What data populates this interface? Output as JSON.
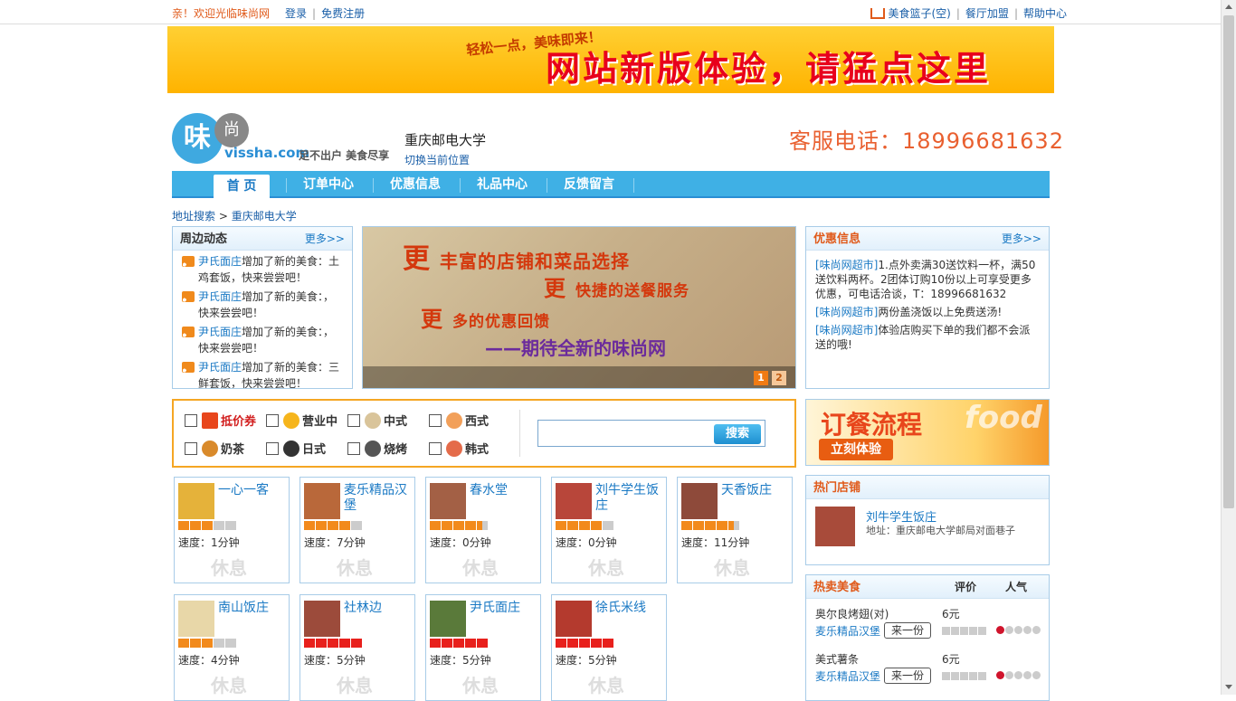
{
  "topbar": {
    "welcome": "亲！欢迎光临味尚网",
    "login": "登录",
    "register": "免费注册",
    "basket": "美食篮子(空)",
    "join": "餐厅加盟",
    "help": "帮助中心"
  },
  "banner": {
    "slogan": "轻松一点，美味即来！",
    "text": "网站新版体验，请猛点这里"
  },
  "header": {
    "logo_char1": "味",
    "logo_char2": "尚",
    "domain": "vissha.com",
    "tagline": "足不出户 美食尽享",
    "location": "重庆邮电大学",
    "switch_location": "切换当前位置",
    "hotline": "客服电话：18996681632"
  },
  "nav": {
    "items": [
      "首 页",
      "订单中心",
      "优惠信息",
      "礼品中心",
      "反馈留言"
    ]
  },
  "breadcrumb": {
    "root": "地址搜索",
    "sep": " > ",
    "current": "重庆邮电大学"
  },
  "news": {
    "title": "周边动态",
    "more": "更多>>",
    "items": [
      {
        "shop": "尹氏面庄",
        "text": "增加了新的美食：土鸡套饭，快来尝尝吧！"
      },
      {
        "shop": "尹氏面庄",
        "text": "增加了新的美食：，快来尝尝吧！"
      },
      {
        "shop": "尹氏面庄",
        "text": "增加了新的美食：，快来尝尝吧！"
      },
      {
        "shop": "尹氏面庄",
        "text": "增加了新的美食：三鲜套饭，快来尝尝吧！"
      }
    ]
  },
  "slideshow": {
    "line1_big": "更",
    "line1": "丰富的店铺和菜品选择",
    "line2_big": "更",
    "line2": "快捷的送餐服务",
    "line3_big": "更",
    "line3": "多的优惠回馈",
    "line4": "——期待全新的味尚网",
    "pages": [
      "1",
      "2"
    ],
    "current_page": 1
  },
  "promos": {
    "title": "优惠信息",
    "more": "更多>>",
    "items": [
      {
        "source": "[味尚网超市]",
        "text": "1.点外卖满30送饮料一杯，满50送饮料两杯。2团体订购10份以上可享受更多优惠，可电话洽谈，T：18996681632"
      },
      {
        "source": "[味尚网超市]",
        "text": "两份盖浇饭以上免费送汤!"
      },
      {
        "source": "[味尚网超市]",
        "text": "体验店购买下单的我们都不会派送的哦!"
      }
    ]
  },
  "filters": {
    "row1": [
      "抵价券",
      "营业中",
      "中式",
      "西式"
    ],
    "row2": [
      "奶茶",
      "日式",
      "烧烤",
      "韩式"
    ],
    "search_button": "搜索",
    "search_value": ""
  },
  "process": {
    "title": "订餐流程",
    "watermark": "food",
    "button": "立刻体验"
  },
  "shops": [
    {
      "name": "一心一客",
      "rating": 3,
      "speed": "速度：1分钟",
      "status": "休息"
    },
    {
      "name": "麦乐精品汉堡",
      "rating": 4,
      "speed": "速度：7分钟",
      "status": "休息"
    },
    {
      "name": "春水堂",
      "rating": 4.5,
      "speed": "速度：0分钟",
      "status": "休息"
    },
    {
      "name": "刘牛学生饭庄",
      "rating": 4,
      "speed": "速度：0分钟",
      "status": "休息"
    },
    {
      "name": "天香饭庄",
      "rating": 4.5,
      "speed": "速度：11分钟",
      "status": "休息"
    },
    {
      "name": "南山饭庄",
      "rating": 3,
      "speed": "速度：4分钟",
      "status": "休息"
    },
    {
      "name": "社林边",
      "rating": 5,
      "speed": "速度：5分钟",
      "status": "休息"
    },
    {
      "name": "尹氏面庄",
      "rating": 5,
      "speed": "速度：5分钟",
      "status": "休息"
    },
    {
      "name": "徐氏米线",
      "rating": 5,
      "speed": "速度：5分钟",
      "status": "休息"
    }
  ],
  "hot_shops": {
    "title": "热门店铺",
    "name": "刘牛学生饭庄",
    "address": "地址：重庆邮电大学邮局对面巷子"
  },
  "hot_food": {
    "title": "热卖美食",
    "col_rating": "评价",
    "col_popularity": "人气",
    "add_label": "来一份",
    "items": [
      {
        "dish": "奥尔良烤翅(对)",
        "price": "6元",
        "shop": "麦乐精品汉堡",
        "popularity": 1
      },
      {
        "dish": "美式薯条",
        "price": "6元",
        "shop": "麦乐精品汉堡",
        "popularity": 1
      }
    ]
  }
}
